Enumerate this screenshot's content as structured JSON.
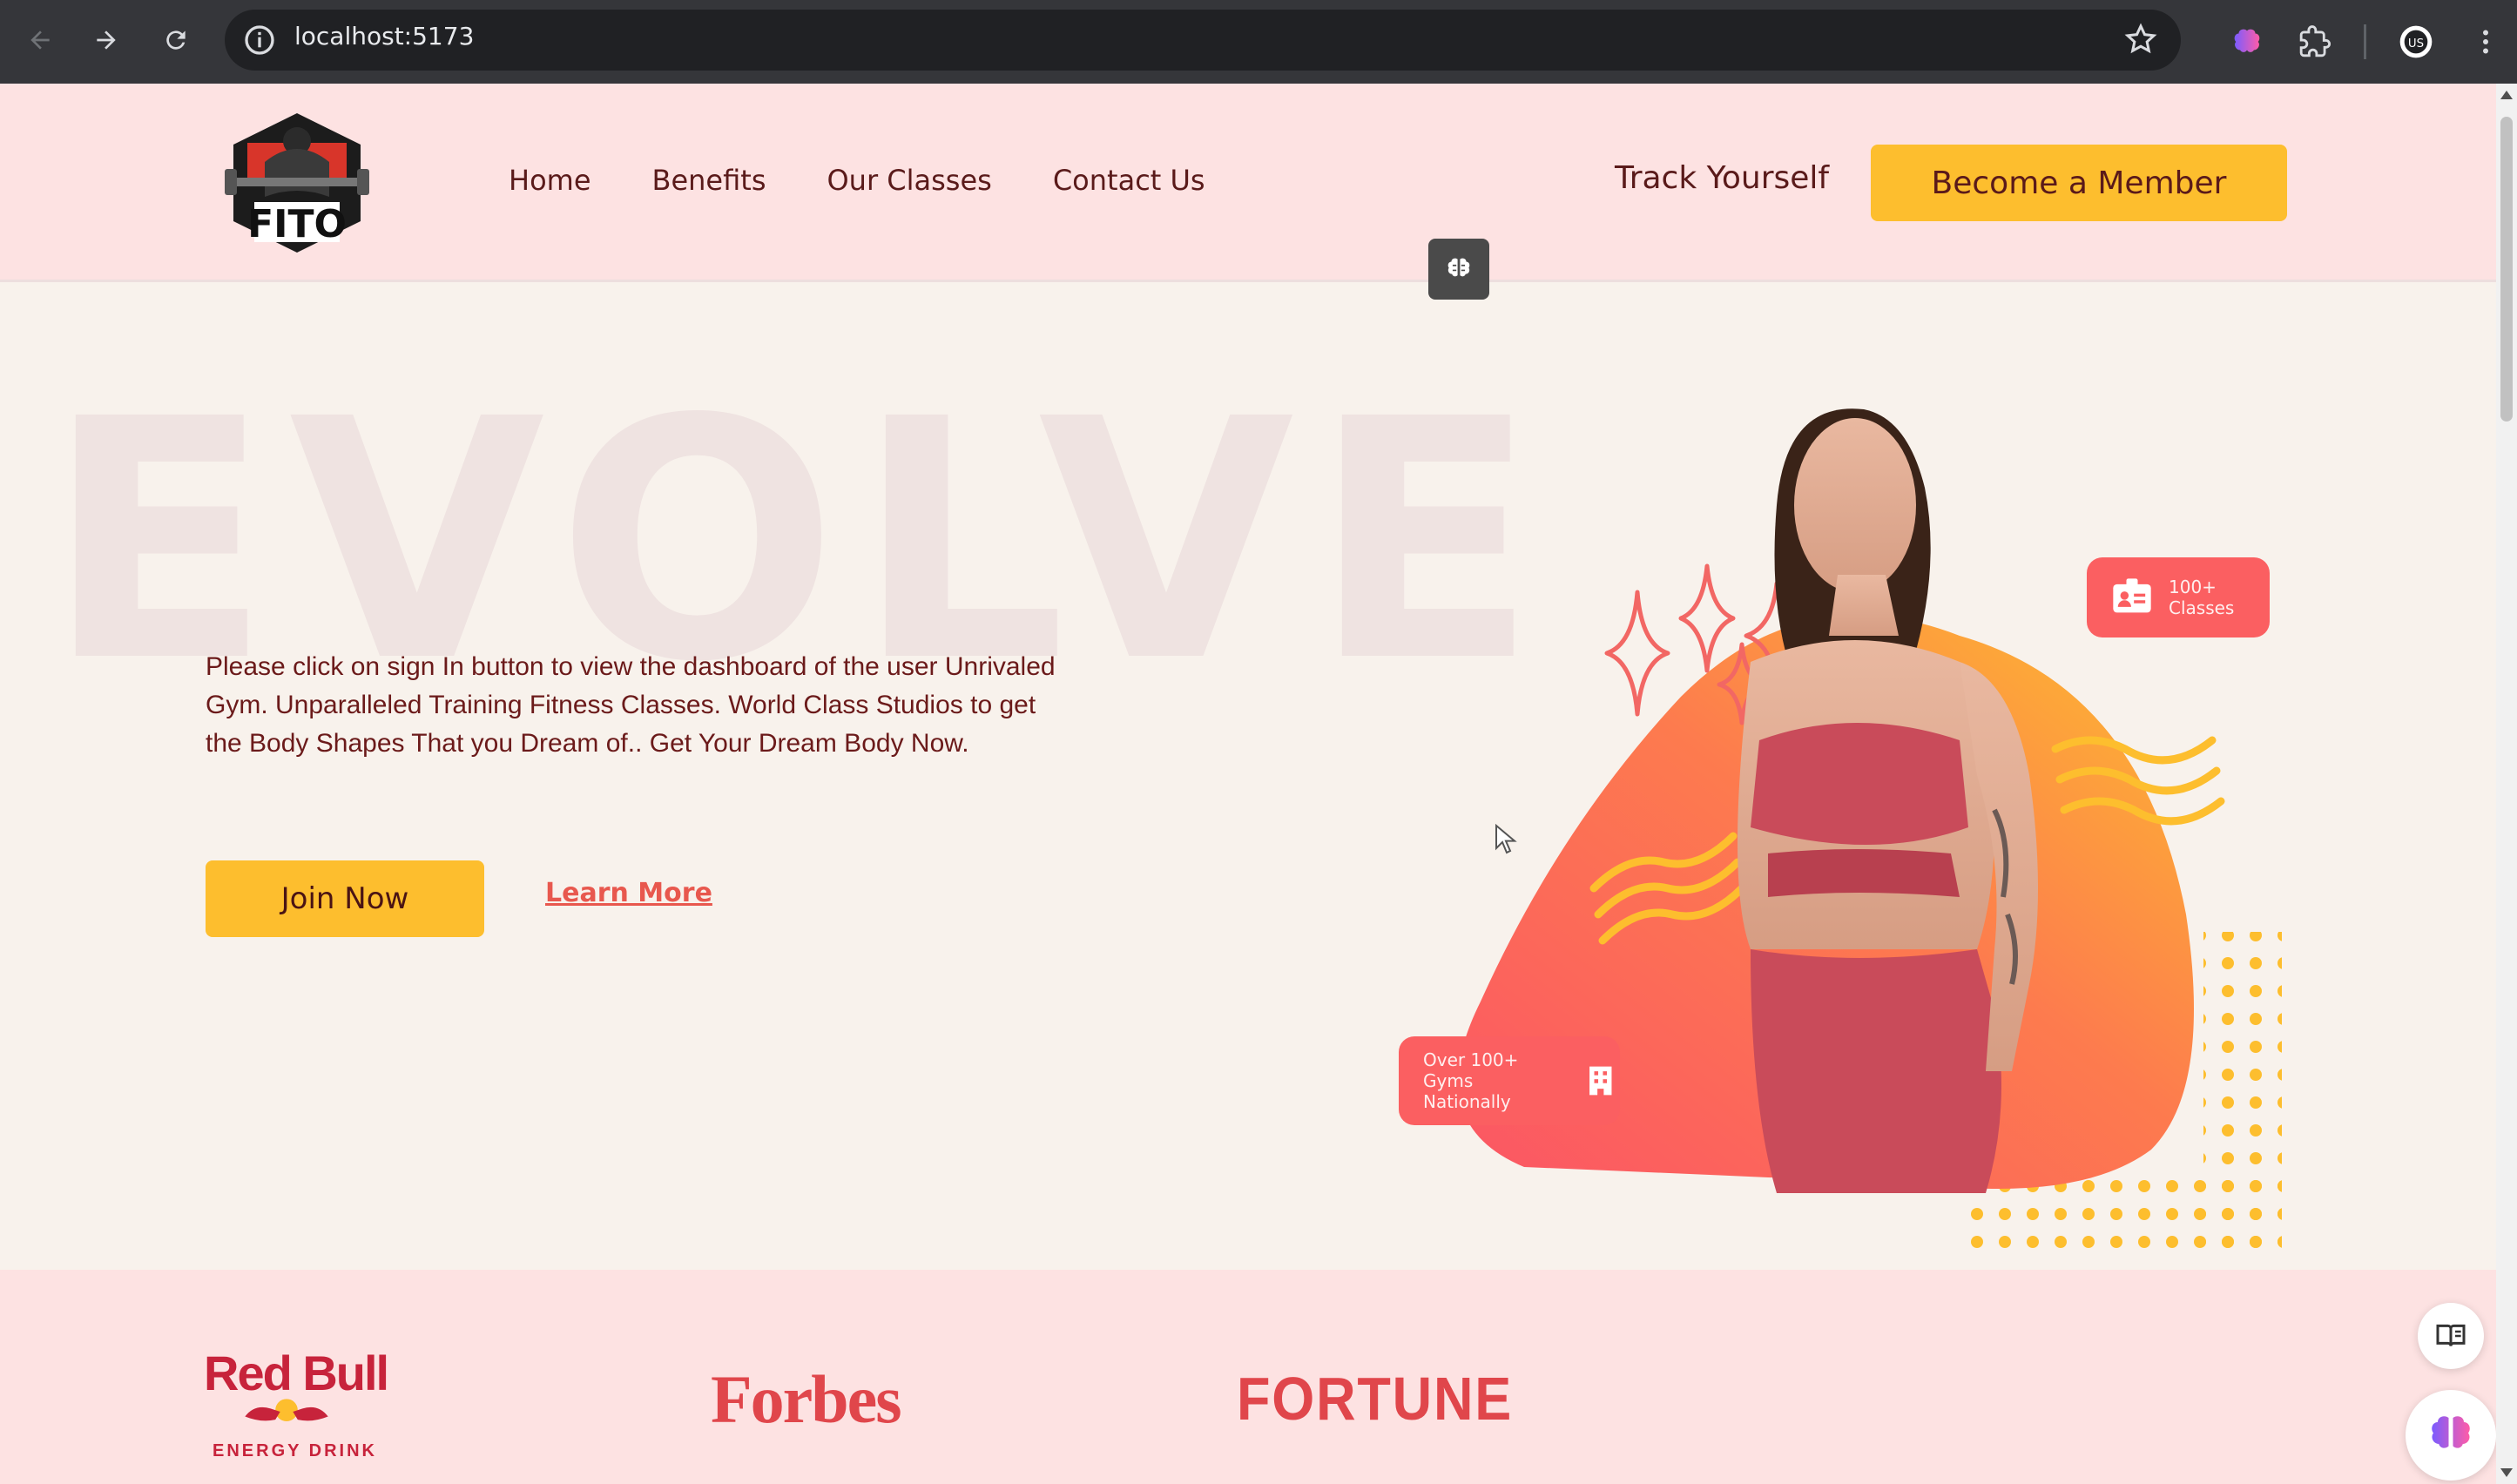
{
  "browser": {
    "url": "localhost:5173"
  },
  "header": {
    "logo_text": "FITO",
    "nav": [
      "Home",
      "Benefits",
      "Our Classes",
      "Contact Us"
    ],
    "track_label": "Track Yourself",
    "member_label": "Become a Member"
  },
  "hero": {
    "bg_word": "EVOLVE",
    "description": "Please click on sign In button to view the dashboard of the user Unrivaled Gym. Unparalleled Training Fitness Classes. World Class Studios to get the Body Shapes That you Dream of.. Get Your Dream Body Now.",
    "join_label": "Join Now",
    "learn_label": "Learn More",
    "badge_classes": [
      "100+",
      "Classes"
    ],
    "badge_gyms": [
      "Over 100+",
      "Gyms Nationally"
    ]
  },
  "brands": {
    "redbull": "Red Bull",
    "redbull_sub": "ENERGY DRINK",
    "forbes": "Forbes",
    "fortune": "FORTUNE"
  },
  "colors": {
    "header_bg": "#fde2e2",
    "accent_yellow": "#fdbe2e",
    "accent_coral": "#fb5f61",
    "text_dark": "#5a1a1a"
  }
}
